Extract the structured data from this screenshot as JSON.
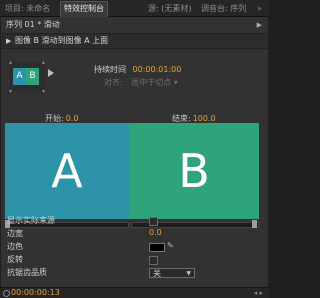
{
  "tabs": [
    {
      "label": "项目: 未命名"
    },
    {
      "label": "特效控制台"
    },
    {
      "label": "源: (无素材)"
    },
    {
      "label": "调音台: 序列"
    }
  ],
  "tab_more": "»",
  "sequence": {
    "label": "序列 01 * 滑动"
  },
  "effect": {
    "label": "图像 B 滑动到图像 A 上面"
  },
  "preview": {
    "a": "A",
    "b": "B"
  },
  "duration": {
    "label": "持续时间",
    "value": "00:00:01:00"
  },
  "alignment": {
    "label": "对齐:",
    "value": "居中于切点"
  },
  "start": {
    "label": "开始:",
    "value": "0.0"
  },
  "end": {
    "label": "结束:",
    "value": "100.0"
  },
  "big": {
    "a": "A",
    "b": "B"
  },
  "props": {
    "show_actual_source": "显示实际来源",
    "border_width": "边宽",
    "border_width_value": "0.0",
    "border_color": "边色",
    "reverse": "反转",
    "antialias_quality": "抗锯齿品质",
    "antialias_value": "关"
  },
  "footer": {
    "timecode": "00:00:00:13"
  },
  "colors": {
    "accent": "#e8a23a",
    "clip_a": "#2d93a8",
    "clip_b": "#2fa47a"
  }
}
